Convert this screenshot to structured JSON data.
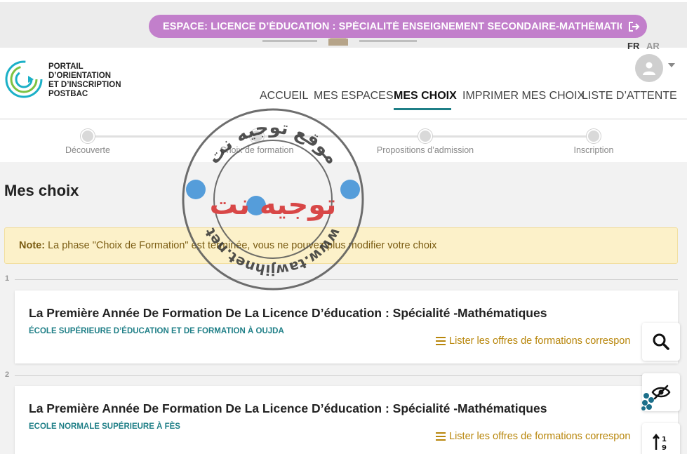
{
  "topbar": {
    "espace_label": "ESPACE: LICENCE D’ÉDUCATION : SPÉCIALITÉ ENSEIGNEMENT SECONDAIRE-MATHÉMATIQUES",
    "logout_icon": "logout-icon",
    "pill_color": "#c27fcb"
  },
  "header": {
    "logo_lines": [
      "PORTAIL",
      "D’ORIENTATION",
      "ET D’INSCRIPTION",
      "POSTBAC"
    ],
    "lang_fr": "FR",
    "lang_ar": "AR"
  },
  "nav": {
    "items": [
      {
        "label": "ACCUEIL"
      },
      {
        "label": "MES ESPACES"
      },
      {
        "label": "MES CHOIX",
        "active": true
      },
      {
        "label": "IMPRIMER MES CHOIX"
      },
      {
        "label": "LISTE D’ATTENTE"
      }
    ],
    "accent": "#1f7f87"
  },
  "steps": [
    {
      "label": "Découverte"
    },
    {
      "label": "Choix de formation"
    },
    {
      "label": "Propositions d’admission"
    },
    {
      "label": "Inscription"
    }
  ],
  "page": {
    "title": "Mes choix",
    "note_label": "Note:",
    "note_text": "La phase \"Choix de Formation\" est terminée, vous ne pouvez plus modifier votre choix"
  },
  "choices": [
    {
      "index": "1",
      "title": "La Première Année De Formation De La Licence D’éducation : Spécialité  -Mathématiques",
      "school": "ÉCOLE SUPÉRIEURE D’ÉDUCATION ET DE FORMATION À OUJDA",
      "link": "Lister les offres de formations correspon"
    },
    {
      "index": "2",
      "title": "La Première Année De Formation De La Licence D’éducation : Spécialité  -Mathématiques",
      "school": "ECOLE NORMALE SUPÉRIEURE À FÈS",
      "link": "Lister les offres de formations correspon"
    }
  ],
  "tools": {
    "icons": [
      "search-icon",
      "eye-slash-icon",
      "sort-icon"
    ]
  },
  "watermark": {
    "arabic_top": "موقع توجيه نت",
    "arabic_center": "توجيه نت",
    "url": "www.tawjihnet.net"
  }
}
